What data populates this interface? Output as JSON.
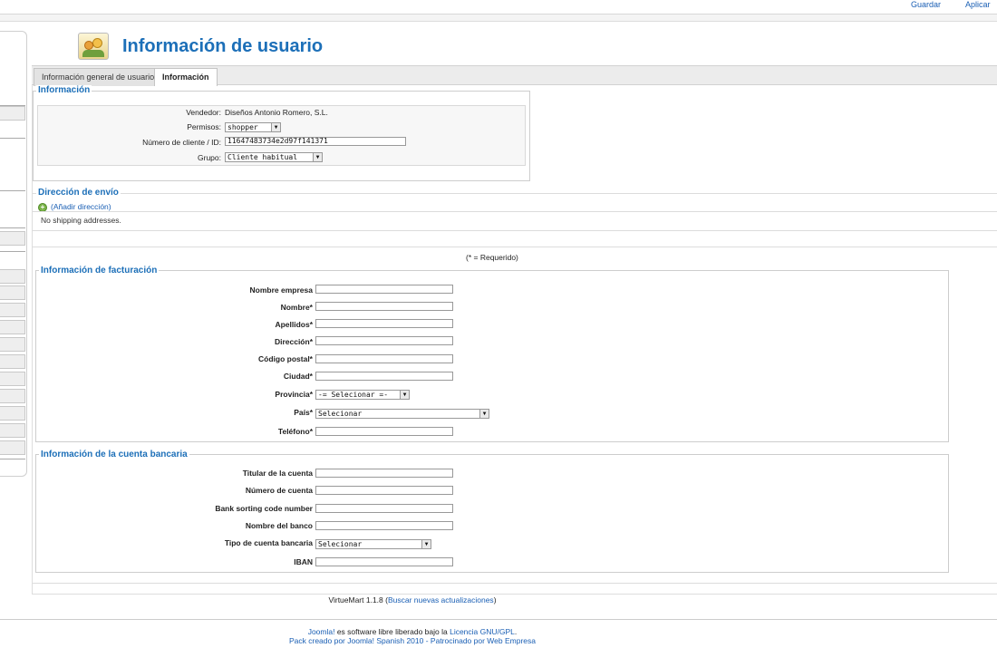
{
  "toolbar": {
    "save": "Guardar",
    "apply": "Aplicar"
  },
  "page": {
    "title": "Información de usuario"
  },
  "tabs": [
    {
      "label": "Información general de usuario"
    },
    {
      "label": "Información"
    }
  ],
  "info": {
    "legend": "Información",
    "vendor_label": "Vendedor:",
    "vendor_value": "Diseños Antonio Romero, S.L.",
    "permissions_label": "Permisos:",
    "permissions_value": "shopper",
    "customer_label": "Número de cliente / ID:",
    "customer_value": "11647483734e2d97f141371",
    "group_label": "Grupo:",
    "group_value": "Cliente habitual"
  },
  "shipping": {
    "legend": "Dirección de envío",
    "add_link": "(Añadir dirección)",
    "empty_text": "No shipping addresses."
  },
  "required_note": "(* = Requerido)",
  "billing": {
    "legend": "Información de facturación",
    "company_label": "Nombre empresa",
    "first_name_label": "Nombre*",
    "last_name_label": "Apellidos*",
    "address_label": "Dirección*",
    "postal_label": "Código postal*",
    "city_label": "Ciudad*",
    "province_label": "Provincia*",
    "province_value": "-= Selecionar =-",
    "country_label": "País*",
    "country_value": "Selecionar",
    "phone_label": "Teléfono*"
  },
  "bank": {
    "legend": "Información de la cuenta bancaria",
    "holder_label": "Titular de la cuenta",
    "account_label": "Número de cuenta",
    "sort_label": "Bank sorting code number",
    "bank_name_label": "Nombre del banco",
    "type_label": "Tipo de cuenta bancaria",
    "type_value": "Selecionar",
    "iban_label": "IBAN"
  },
  "version": {
    "text": "VirtueMart 1.1.8 (",
    "link": "Buscar nuevas actualizaciones",
    "close": ")"
  },
  "footer": {
    "joomla": "Joomla!",
    "free": " es software libre liberado bajo la ",
    "license": "Licencia GNU/GPL",
    "dot": ".",
    "pack": "Pack creado por Joomla! Spanish 2010",
    "sep": " - ",
    "sponsor": "Patrocinado por Web Empresa"
  }
}
